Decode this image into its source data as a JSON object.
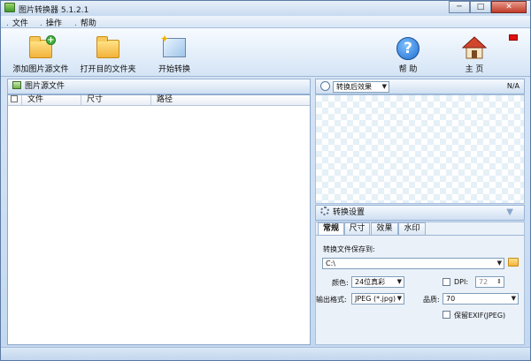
{
  "window": {
    "title": "图片转换器 5.1.2.1",
    "min": "─",
    "max": "□",
    "close": "✕"
  },
  "menu": [
    {
      "label": "文件"
    },
    {
      "label": "操作"
    },
    {
      "label": "帮助"
    }
  ],
  "toolbar": {
    "add_source": "添加图片源文件",
    "open_dest": "打开目的文件夹",
    "start": "开始转换",
    "help": "帮 助",
    "home": "主 页"
  },
  "source_panel": {
    "title": "图片源文件",
    "columns": [
      "文件",
      "尺寸",
      "路径"
    ]
  },
  "preview_panel": {
    "mode": "转换后效果",
    "size": "N/A"
  },
  "settings_panel": {
    "title": "转换设置",
    "tabs": [
      "常规",
      "尺寸",
      "效果",
      "水印"
    ],
    "save_to_label": "转换文件保存到:",
    "save_path": "C:\\",
    "color_label": "颜色:",
    "color_value": "24位真彩",
    "dpi_label": "DPI:",
    "dpi_value": "72",
    "format_label": "输出格式:",
    "format_value": "JPEG (*.jpg)",
    "quality_label": "品质:",
    "quality_value": "70",
    "keep_exif_label": "保留EXIF(JPEG)"
  },
  "colors": {
    "accent": "#1f6fd0",
    "titlebar": "#c8dbf0",
    "close": "#c13b28"
  }
}
